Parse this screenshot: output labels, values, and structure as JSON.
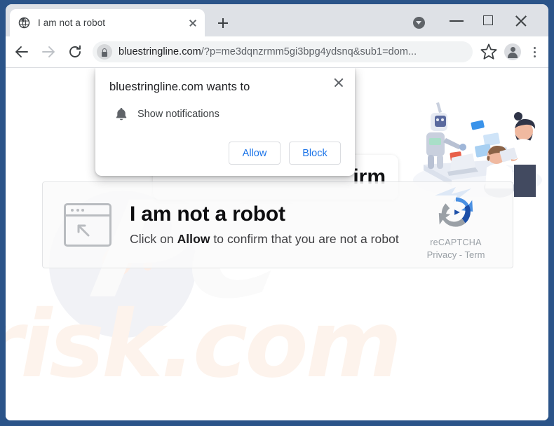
{
  "browser": {
    "tab": {
      "title": "I am not a robot",
      "favicon_icon": "globe-icon",
      "close_icon": "close-icon"
    },
    "new_tab_icon": "plus-icon",
    "window_controls": {
      "download_icon": "download-arrow-icon",
      "minimize_icon": "minimize-icon",
      "maximize_icon": "maximize-icon",
      "close_icon": "close-icon"
    },
    "toolbar": {
      "back_icon": "arrow-left-icon",
      "forward_icon": "arrow-right-icon",
      "reload_icon": "reload-icon",
      "lock_icon": "lock-icon",
      "url_prefix": "bluestringline.com",
      "url_query": "/?p=me3dqnzrmm5gi3bpg4ydsnq&sub1=dom...",
      "bookmark_icon": "star-icon",
      "profile_icon": "account-avatar-icon",
      "menu_icon": "three-dot-menu-icon"
    }
  },
  "permission_dialog": {
    "title": "bluestringline.com wants to",
    "permission_icon": "bell-icon",
    "permission_label": "Show notifications",
    "close_icon": "close-icon",
    "allow_label": "Allow",
    "block_label": "Block"
  },
  "page": {
    "confirm_fragment": "irm",
    "robot": {
      "icon": "browser-window-cursor-icon",
      "heading": "I am not a robot",
      "sub_prefix": "Click on ",
      "sub_bold": "Allow",
      "sub_suffix": " to confirm that you are not a robot"
    },
    "recaptcha": {
      "logo_icon": "recaptcha-logo-icon",
      "name": "reCAPTCHA",
      "terms": "Privacy - Term"
    },
    "illustration_icon": "robot-and-people-illustration",
    "watermark_main": "risk.com",
    "watermark_secondary": "PC"
  },
  "colors": {
    "window_frame": "#2b5489",
    "tabstrip": "#dee1e6",
    "omnibox": "#f1f3f4",
    "accent_blue": "#1a73e8",
    "recaptcha_blue": "#1c72e8",
    "recaptcha_gray": "#9aa0a6",
    "watermark": "#fdf3ec"
  }
}
